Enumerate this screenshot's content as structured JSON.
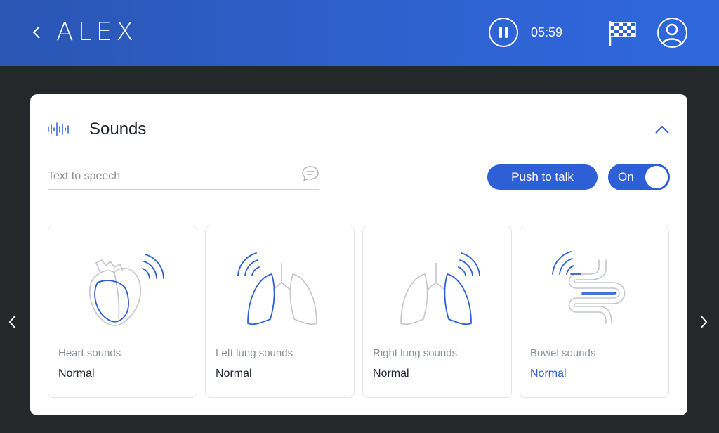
{
  "header": {
    "logo_text": "ALEX",
    "timer": "05:59",
    "back_icon": "chevron-left-icon",
    "pause_icon": "pause-icon",
    "finish_icon": "checkered-flag-icon",
    "user_icon": "user-icon"
  },
  "panel": {
    "title": "Sounds",
    "title_icon": "sound-wave-icon",
    "collapse_icon": "chevron-up-icon",
    "tts_placeholder": "Text to speech",
    "push_to_talk_label": "Push to talk",
    "toggle_label": "On"
  },
  "tiles": [
    {
      "label": "Heart sounds",
      "value": "Normal",
      "icon": "heart-icon"
    },
    {
      "label": "Left lung sounds",
      "value": "Normal",
      "icon": "left-lung-icon"
    },
    {
      "label": "Right lung sounds",
      "value": "Normal",
      "icon": "right-lung-icon"
    },
    {
      "label": "Bowel sounds",
      "value": "Normal",
      "icon": "bowel-icon"
    }
  ],
  "colors": {
    "header": "#2f62d0",
    "background": "#25282b",
    "accent": "#2f5fd6",
    "line_gray": "#c2c5cb"
  }
}
